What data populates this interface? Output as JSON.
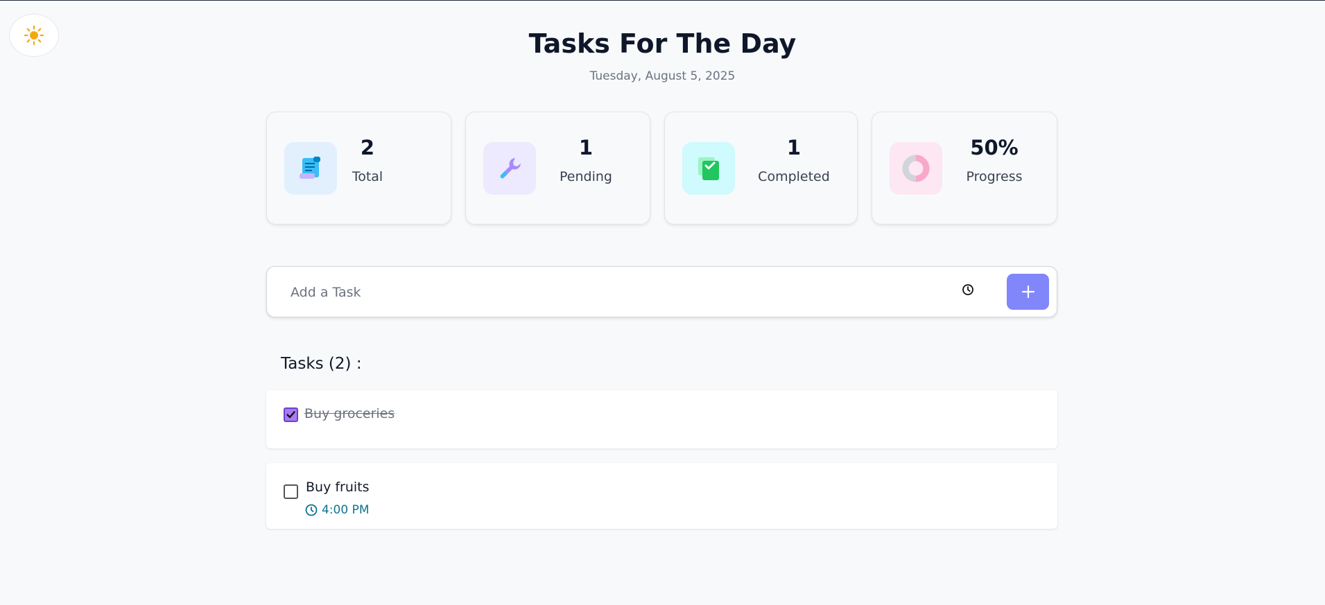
{
  "header": {
    "title": "Tasks For The Day",
    "date": "Tuesday, August 5, 2025",
    "theme_icon": "sun-icon"
  },
  "stats": [
    {
      "value": "2",
      "label": "Total",
      "icon": "scroll-icon",
      "icon_bg": "#e2f0fd"
    },
    {
      "value": "1",
      "label": "Pending",
      "icon": "wrench-icon",
      "icon_bg": "#ede9fe"
    },
    {
      "value": "1",
      "label": "Completed",
      "icon": "checklist-icon",
      "icon_bg": "#cffafe"
    },
    {
      "value": "50%",
      "label": "Progress",
      "icon": "donut-chart-icon",
      "icon_bg": "#fce7f3"
    }
  ],
  "add_task": {
    "placeholder": "Add a Task",
    "value": "",
    "add_button_label": "+",
    "accent": "#8186fa"
  },
  "tasks_section": {
    "heading": "Tasks (2) :"
  },
  "tasks": [
    {
      "title": "Buy groceries",
      "completed": true,
      "time": ""
    },
    {
      "title": "Buy fruits",
      "completed": false,
      "time": "4:00 PM"
    }
  ],
  "colors": {
    "time_accent": "#0e7490",
    "checkbox_checked": "#a97bf2",
    "sun": "#f2a90f"
  }
}
